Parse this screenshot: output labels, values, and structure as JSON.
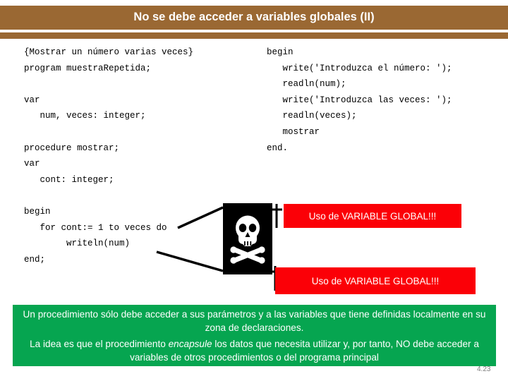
{
  "slide": {
    "title": "No se debe acceder a variables globales (II)",
    "page_number": "4.23",
    "colors": {
      "title_bar": "#9a6833",
      "warning_red": "#fb0007",
      "summary_green": "#06a550",
      "skull_box": "#000000",
      "text_white": "#ffffff"
    }
  },
  "code": {
    "left_column": "{Mostrar un número varias veces}\nprogram muestraRepetida;\n\nvar\n   num, veces: integer;\n\nprocedure mostrar;\nvar\n   cont: integer;\n\nbegin\n   for cont:= 1 to veces do\n        writeln(num)\nend;",
    "right_column": "begin\n   write('Introduzca el número: ');\n   readln(num);\n   write('Introduzca las veces: ');\n   readln(veces);\n   mostrar\nend."
  },
  "callouts": {
    "skull_label": "skull-and-crossbones",
    "warning_1": "Uso de VARIABLE GLOBAL!!!",
    "warning_2": "Uso de VARIABLE GLOBAL!!!"
  },
  "summary": {
    "paragraph_1": "Un procedimiento sólo debe acceder a sus parámetros y a las variables que tiene definidas localmente en su zona de declaraciones.",
    "paragraph_2_before": "La idea es que el procedimiento ",
    "paragraph_2_italic": "encapsule",
    "paragraph_2_after": " los datos que necesita utilizar y, por tanto, NO debe acceder a variables de otros procedimientos o del programa principal"
  }
}
